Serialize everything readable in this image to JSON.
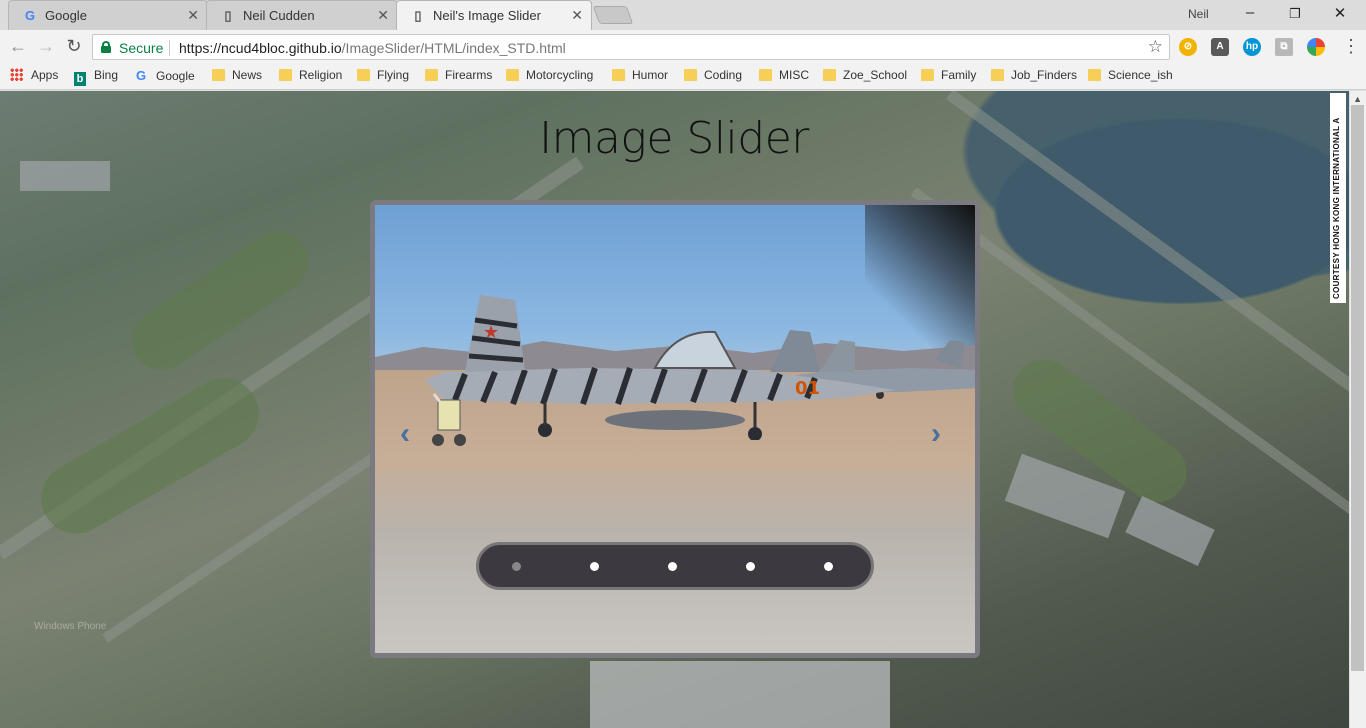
{
  "browser": {
    "tabs": [
      {
        "title": "Google",
        "icon": "google-icon"
      },
      {
        "title": "Neil Cudden",
        "icon": "page-icon"
      },
      {
        "title": "Neil's Image Slider",
        "icon": "page-icon"
      }
    ],
    "profile_name": "Neil",
    "secure_label": "Secure",
    "url_host": "https://ncud4bloc.github.io",
    "url_path": "/ImageSlider/HTML/index_STD.html",
    "bookmarks": [
      "Apps",
      "Bing",
      "Google",
      "News",
      "Religion",
      "Flying",
      "Firearms",
      "Motorcycling",
      "Humor",
      "Coding",
      "MISC",
      "Zoe_School",
      "Family",
      "Job_Finders",
      "Science_ish"
    ]
  },
  "page": {
    "title": "Image Slider",
    "courtesy": "COURTESY HONG KONG INTERNATIONAL A",
    "watermark": "Windows Phone"
  },
  "slider": {
    "prev_label": "‹",
    "next_label": "›",
    "dot_count": 5,
    "active_dot": 0
  },
  "colors": {
    "secure_green": "#0b8043",
    "folder_yellow": "#f5cf56",
    "arrow_blue": "#4a6f9a",
    "dots_bar": "#3c3a40"
  }
}
